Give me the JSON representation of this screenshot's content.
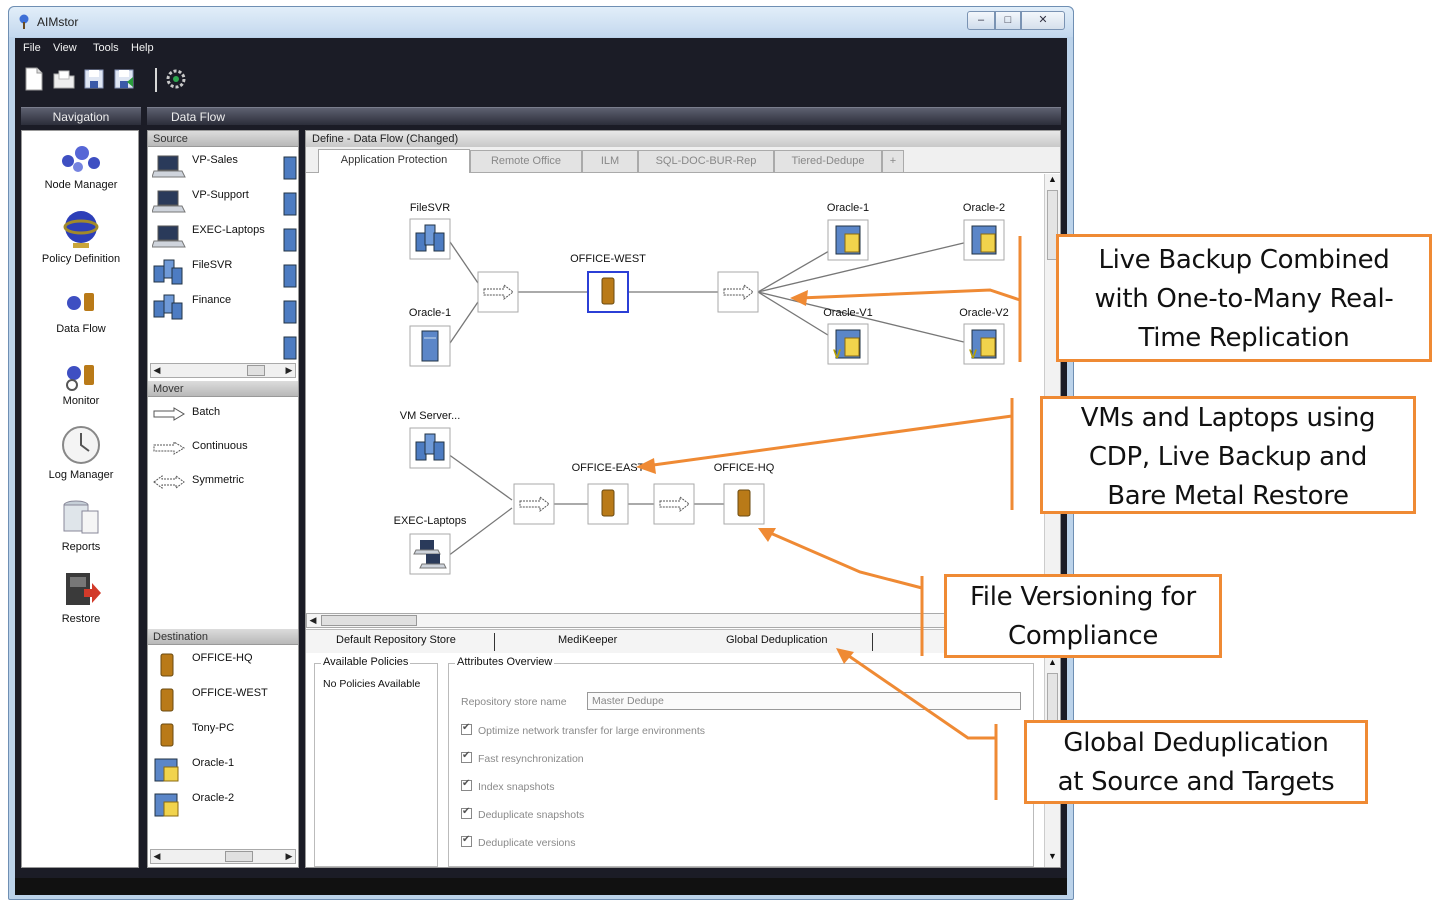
{
  "window": {
    "title": "AIMstor",
    "min": "–",
    "max": "□",
    "close": "✕"
  },
  "menu": [
    "File",
    "View",
    "Tools",
    "Help"
  ],
  "headers": {
    "navigation": "Navigation",
    "data_flow": "Data Flow"
  },
  "nav": [
    {
      "label": "Node Manager",
      "icon": "node-manager-icon"
    },
    {
      "label": "Policy Definition",
      "icon": "policy-definition-icon"
    },
    {
      "label": "Data Flow",
      "icon": "data-flow-icon"
    },
    {
      "label": "Monitor",
      "icon": "monitor-icon"
    },
    {
      "label": "Log Manager",
      "icon": "log-manager-icon"
    },
    {
      "label": "Reports",
      "icon": "reports-icon"
    },
    {
      "label": "Restore",
      "icon": "restore-icon"
    }
  ],
  "source": {
    "header": "Source",
    "items": [
      "VP-Sales",
      "VP-Support",
      "EXEC-Laptops",
      "FileSVR",
      "Finance"
    ]
  },
  "mover": {
    "header": "Mover",
    "items": [
      "Batch",
      "Continuous",
      "Symmetric"
    ]
  },
  "destination": {
    "header": "Destination",
    "items": [
      "OFFICE-HQ",
      "OFFICE-WEST",
      "Tony-PC",
      "Oracle-1",
      "Oracle-2"
    ]
  },
  "define": {
    "title": "Define - Data Flow (Changed)",
    "tabs": [
      "Application Protection",
      "Remote Office",
      "ILM",
      "SQL-DOC-BUR-Rep",
      "Tiered-Dedupe",
      "+"
    ]
  },
  "diagram": {
    "nodes": {
      "filesvr": "FileSVR",
      "oracle1_src": "Oracle-1",
      "office_west": "OFFICE-WEST",
      "oracle1": "Oracle-1",
      "oracle2": "Oracle-2",
      "oracle_v1": "Oracle-V1",
      "oracle_v2": "Oracle-V2",
      "vm_server": "VM Server...",
      "exec_laptops": "EXEC-Laptops",
      "office_east": "OFFICE-EAST",
      "office_hq": "OFFICE-HQ"
    }
  },
  "bottom": {
    "tabs": [
      "Default Repository Store",
      "MediKeeper",
      "Global Deduplication"
    ],
    "available_policies_title": "Available Policies",
    "no_policies": "No Policies Available",
    "attributes_title": "Attributes Overview",
    "repo_label": "Repository store name",
    "repo_value": "Master Dedupe",
    "checkboxes": [
      "Optimize network transfer for large environments",
      "Fast resynchronization",
      "Index snapshots",
      "Deduplicate snapshots",
      "Deduplicate versions"
    ]
  },
  "callouts": [
    {
      "lines": [
        "Live Backup Combined",
        "with One-to-Many Real-",
        "Time Replication"
      ]
    },
    {
      "lines": [
        "VMs and Laptops using",
        "CDP, Live Backup and",
        "Bare Metal Restore"
      ]
    },
    {
      "lines": [
        "File Versioning for",
        "Compliance"
      ]
    },
    {
      "lines": [
        "Global Deduplication",
        "at Source and Targets"
      ]
    }
  ],
  "colors": {
    "accent": "#ef8a34",
    "dark_frame": "#1b1c26",
    "selection": "#2b3fd6"
  }
}
